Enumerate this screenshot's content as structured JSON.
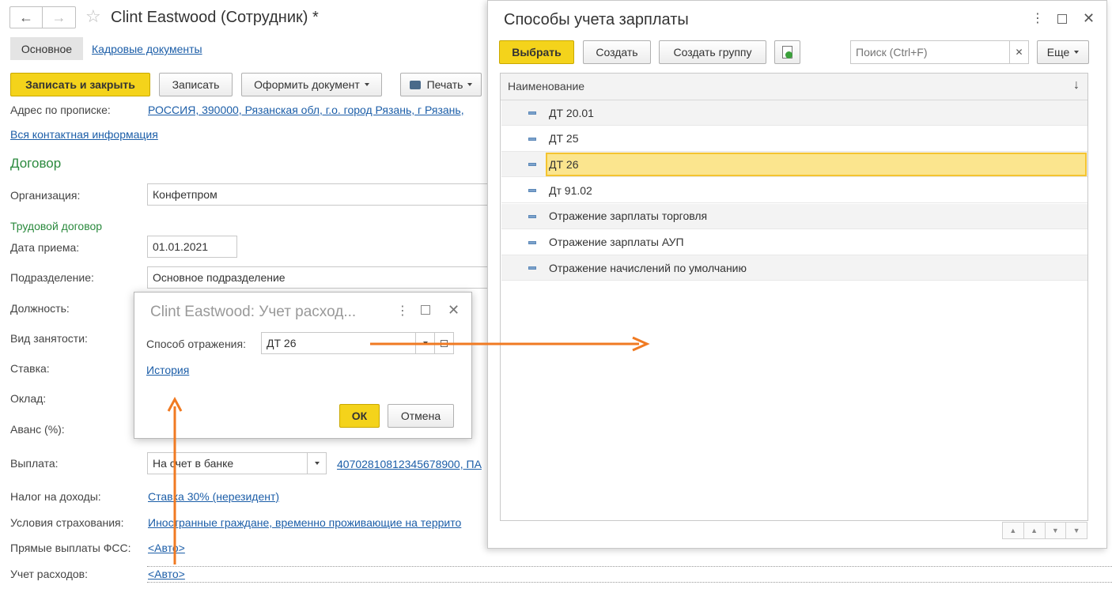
{
  "main": {
    "title": "Clint Eastwood (Сотрудник) *",
    "tabs": [
      "Основное",
      "Кадровые документы"
    ],
    "toolbar": {
      "save_close": "Записать и закрыть",
      "save": "Записать",
      "make_doc": "Оформить документ",
      "print": "Печать"
    },
    "address_label": "Адрес по прописке:",
    "address_value": "РОССИЯ, 390000, Рязанская обл, г.о. город Рязань, г Рязань,",
    "all_contacts": "Вся контактная информация",
    "section_contract": "Договор",
    "org_label": "Организация:",
    "org_value": "Конфетпром",
    "labor_contract": "Трудовой договор",
    "hire_date_label": "Дата приема:",
    "hire_date_value": "01.01.2021",
    "dept_label": "Подразделение:",
    "dept_value": "Основное подразделение",
    "position_label": "Должность:",
    "employment_label": "Вид занятости:",
    "rate_label": "Ставка:",
    "salary_label": "Оклад:",
    "advance_label": "Аванс (%):",
    "payment_label": "Выплата:",
    "payment_value": "На счет в банке",
    "payment_account": "40702810812345678900, ПА",
    "tax_label": "Налог на доходы:",
    "tax_value": "Ставка 30% (нерезидент)",
    "insurance_label": "Условия страхования:",
    "insurance_value": "Иностранные граждане, временно проживающие на террито",
    "fss_label": "Прямые выплаты ФСС:",
    "fss_value": "<Авто>",
    "expense_label": "Учет расходов:",
    "expense_value": "<Авто>"
  },
  "small_dialog": {
    "title": "Clint Eastwood: Учет расход...",
    "method_label": "Способ отражения:",
    "method_value": "ДТ 26",
    "history": "История",
    "ok": "ОК",
    "cancel": "Отмена"
  },
  "right_dialog": {
    "title": "Способы учета зарплаты",
    "choose": "Выбрать",
    "create": "Создать",
    "create_group": "Создать группу",
    "search_placeholder": "Поиск (Ctrl+F)",
    "more": "Еще",
    "column_header": "Наименование",
    "sort_glyph": "↓",
    "items": [
      "ДТ 20.01",
      "ДТ 25",
      "ДТ 26",
      "Дт 91.02",
      "Отражение зарплаты торговля",
      "Отражение зарплаты АУП",
      "Отражение начислений по умолчанию"
    ],
    "selected_index": 2
  },
  "colors": {
    "accent_yellow": "#f4d31b",
    "selection": "#fbe58e",
    "link": "#1c5ea8",
    "section_green": "#2b8a3e",
    "arrow_orange": "#f07a22"
  }
}
